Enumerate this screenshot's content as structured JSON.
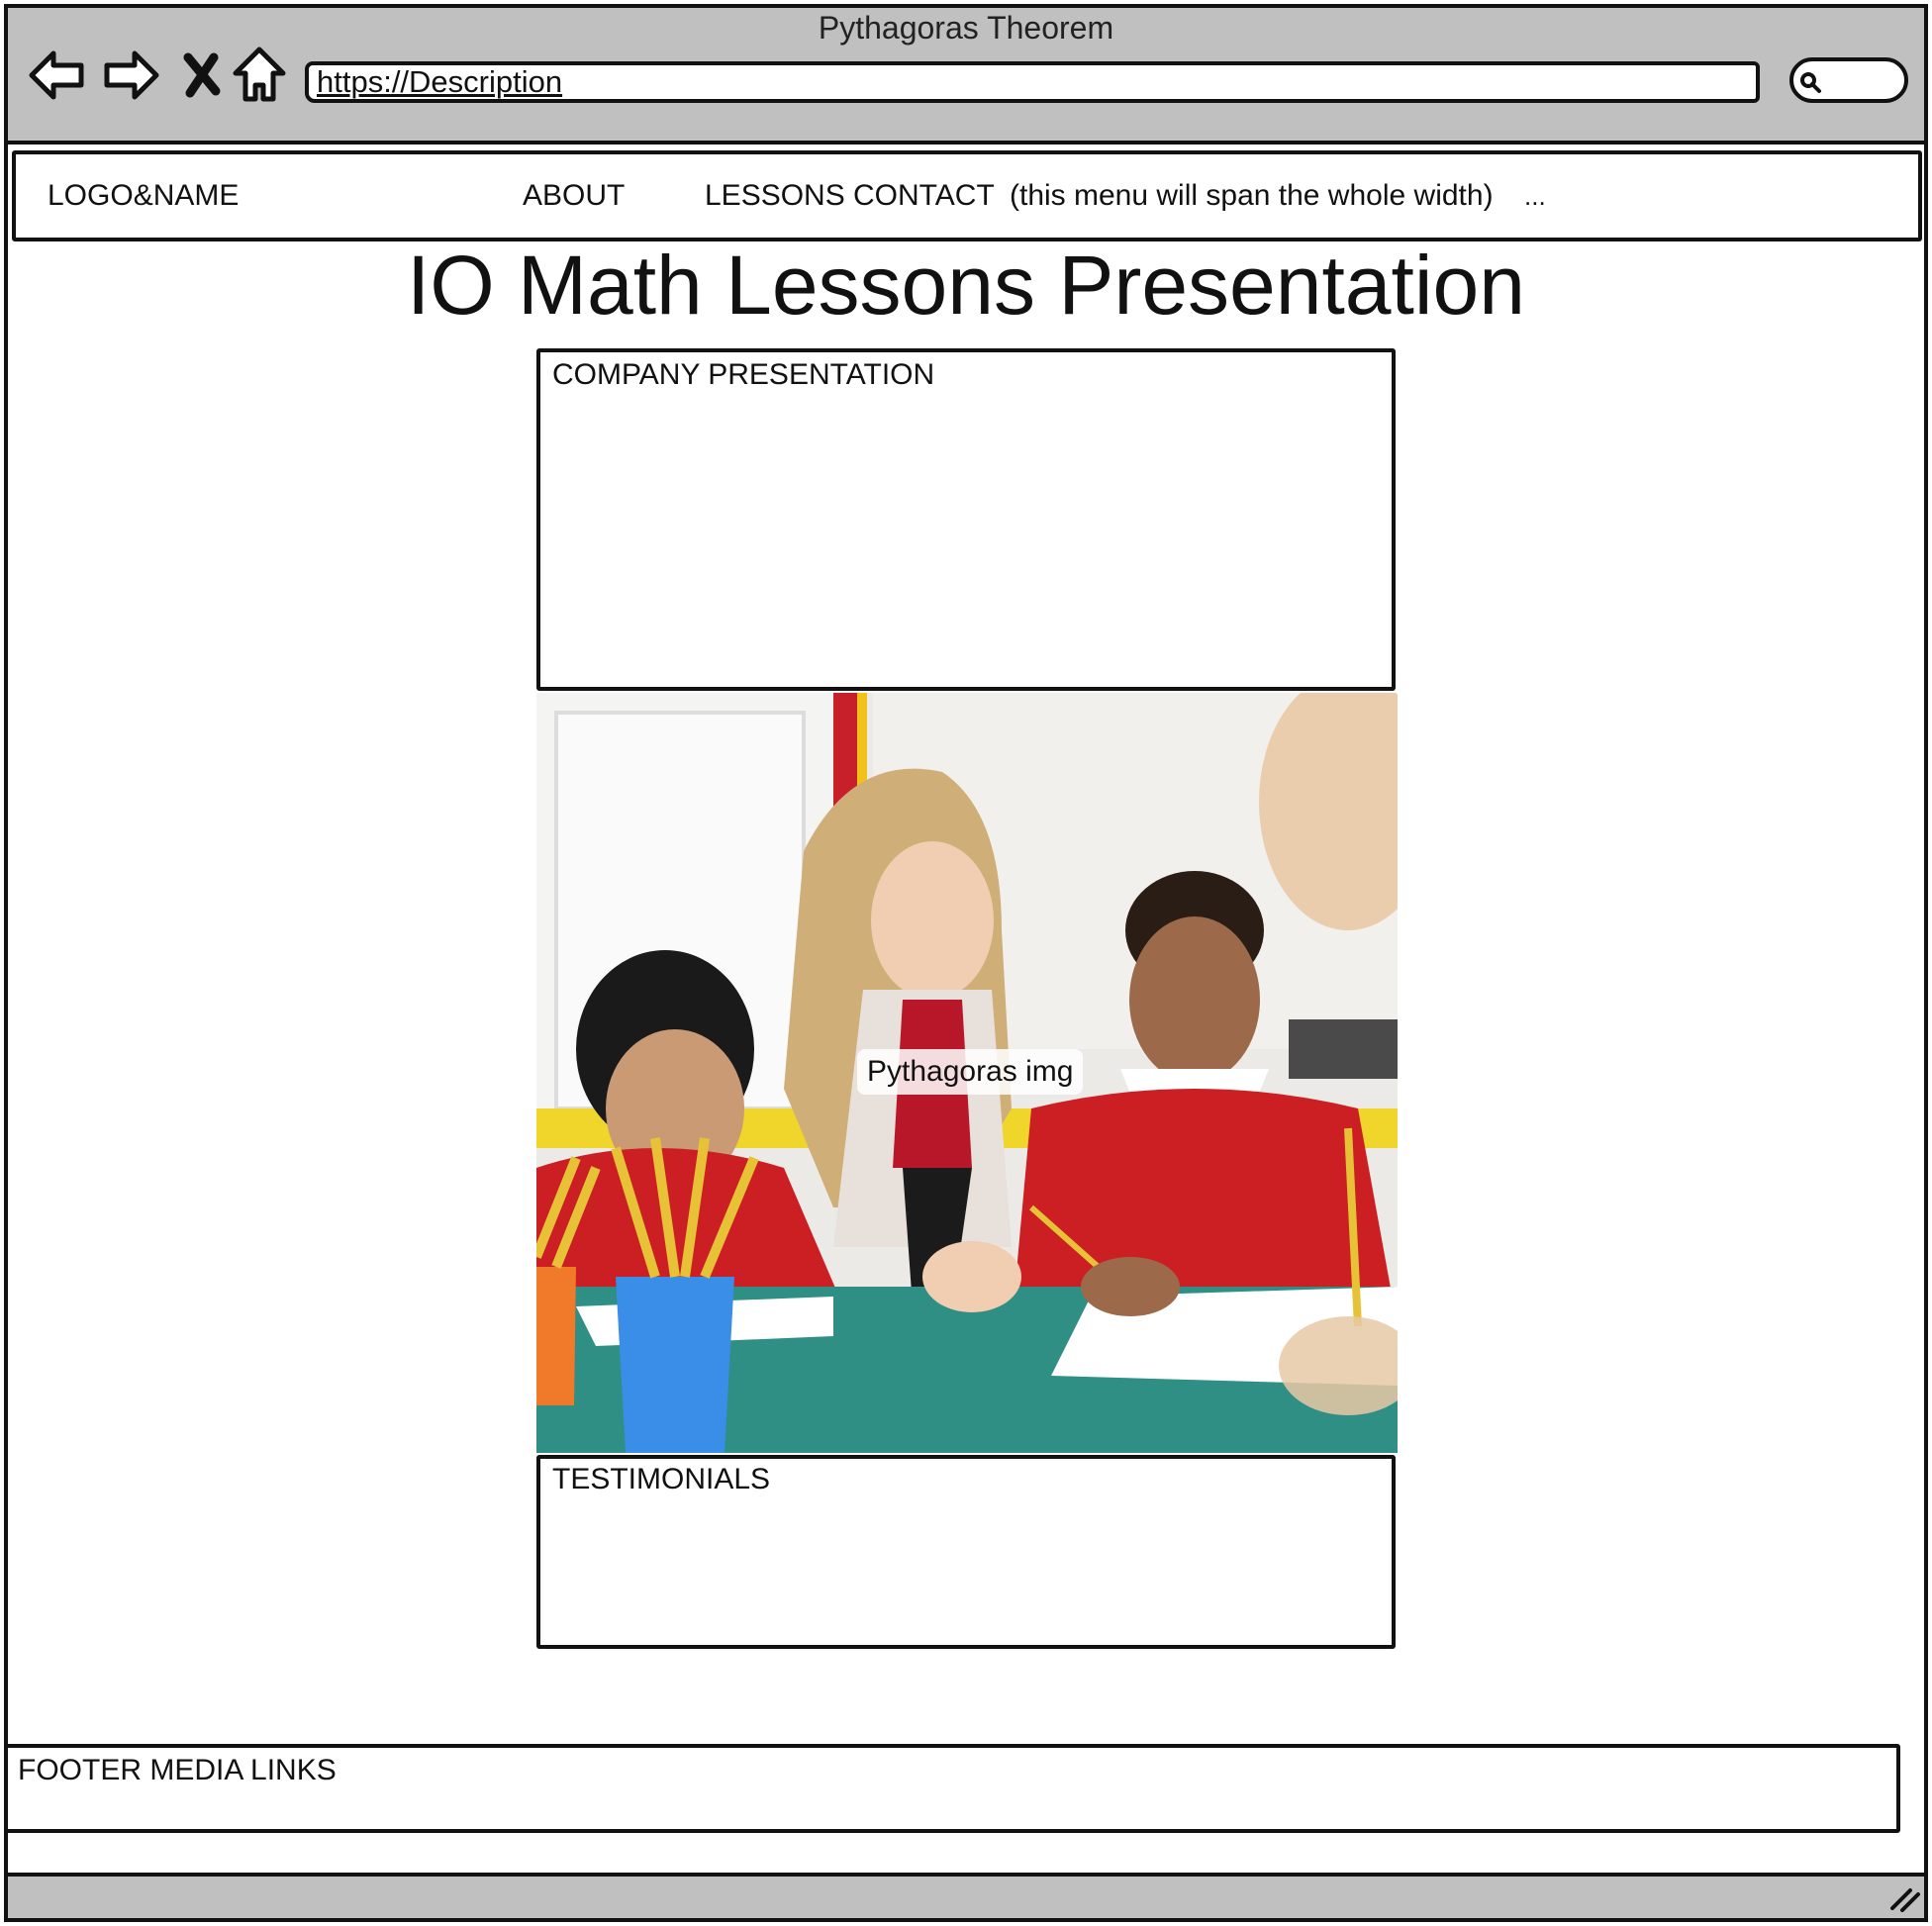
{
  "browser": {
    "window_title": "Pythagoras Theorem",
    "url": "https://Description",
    "icons": [
      "back-arrow-icon",
      "forward-arrow-icon",
      "close-x-icon",
      "home-icon",
      "search-icon",
      "resize-grip-icon"
    ]
  },
  "nav": {
    "logo": "LOGO&NAME",
    "about": "ABOUT",
    "lessons": "LESSONS",
    "contact": "CONTACT",
    "note": "(this menu will span the whole width)",
    "more": "..."
  },
  "main": {
    "heading": "IO Math Lessons Presentation",
    "company_presentation": "COMPANY PRESENTATION",
    "image_caption": "Pythagoras img",
    "testimonials": "TESTIMONIALS"
  },
  "footer": {
    "label": "FOOTER MEDIA LINKS"
  },
  "colors": {
    "chrome": "#c0c0c0",
    "outline": "#111111",
    "uniform_red": "#cc1f24"
  }
}
